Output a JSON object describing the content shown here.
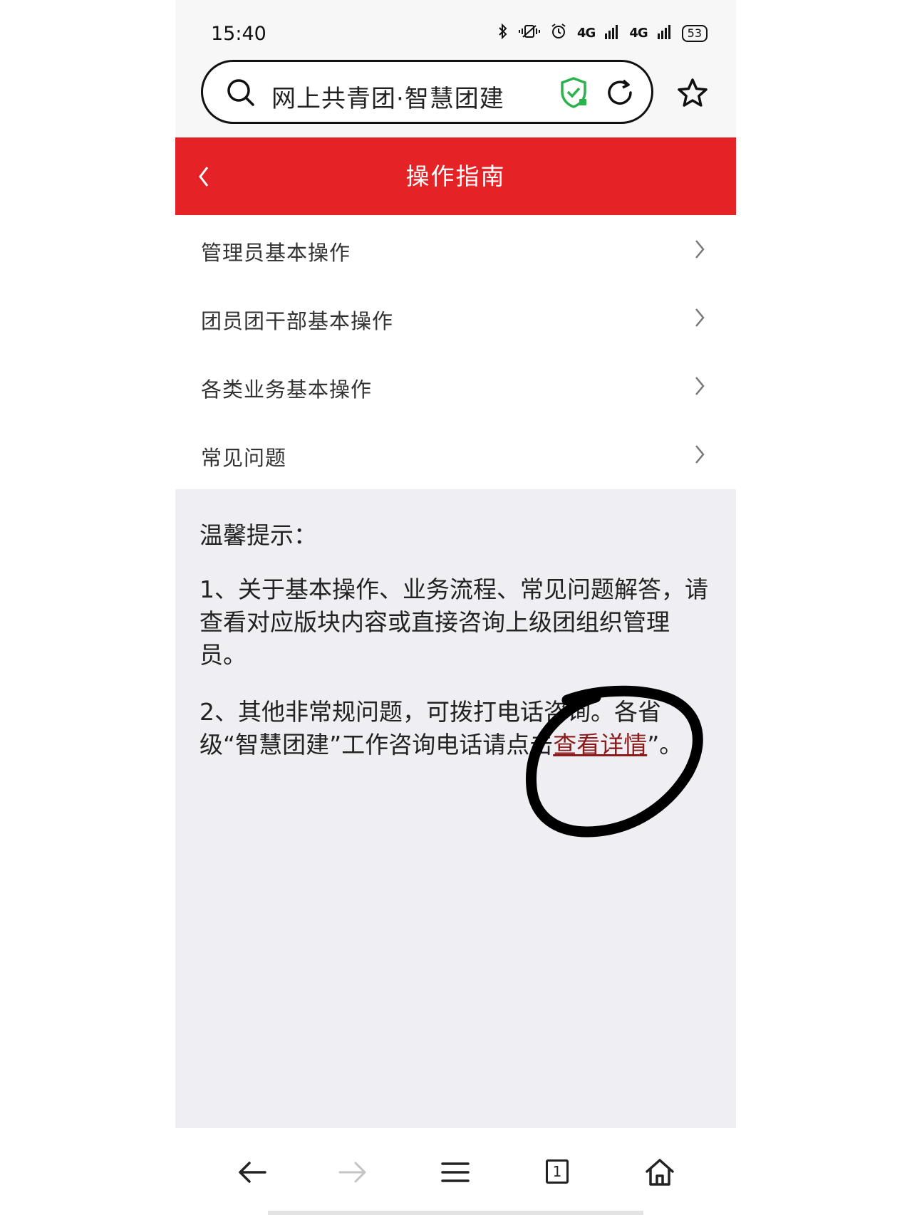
{
  "status_bar": {
    "time": "15:40",
    "bluetooth_icon": "bluetooth-icon",
    "vibrate_icon": "vibrate-icon",
    "alarm_icon": "alarm-icon",
    "signal_1": "4G",
    "signal_2": "4G",
    "battery": "53"
  },
  "browser": {
    "address_text": "网上共青团·智慧团建",
    "icons": [
      "search-icon",
      "shield-check-icon",
      "reload-icon",
      "star-icon"
    ],
    "accent_color": "#2bb24c"
  },
  "header": {
    "title": "操作指南",
    "background_color": "#e52326"
  },
  "menu": {
    "items": [
      {
        "label": "管理员基本操作"
      },
      {
        "label": "团员团干部基本操作"
      },
      {
        "label": "各类业务基本操作"
      },
      {
        "label": "常见问题"
      }
    ]
  },
  "tips": {
    "title": "温馨提示：",
    "item_1": "1、关于基本操作、业务流程、常见问题解答，请查看对应版块内容或直接咨询上级团组织管理员。",
    "item_2_prefix": "2、其他非常规问题，可拨打电话咨询。各省级“智慧团建”工作咨询电话请点击",
    "item_2_link": "查看详情",
    "item_2_suffix": "”。",
    "link_color": "#8b1b1b"
  },
  "bottom_nav": {
    "tabs_count": "1",
    "icons": [
      "back-arrow-icon",
      "forward-arrow-icon",
      "menu-icon",
      "tabs-icon",
      "home-icon"
    ]
  }
}
